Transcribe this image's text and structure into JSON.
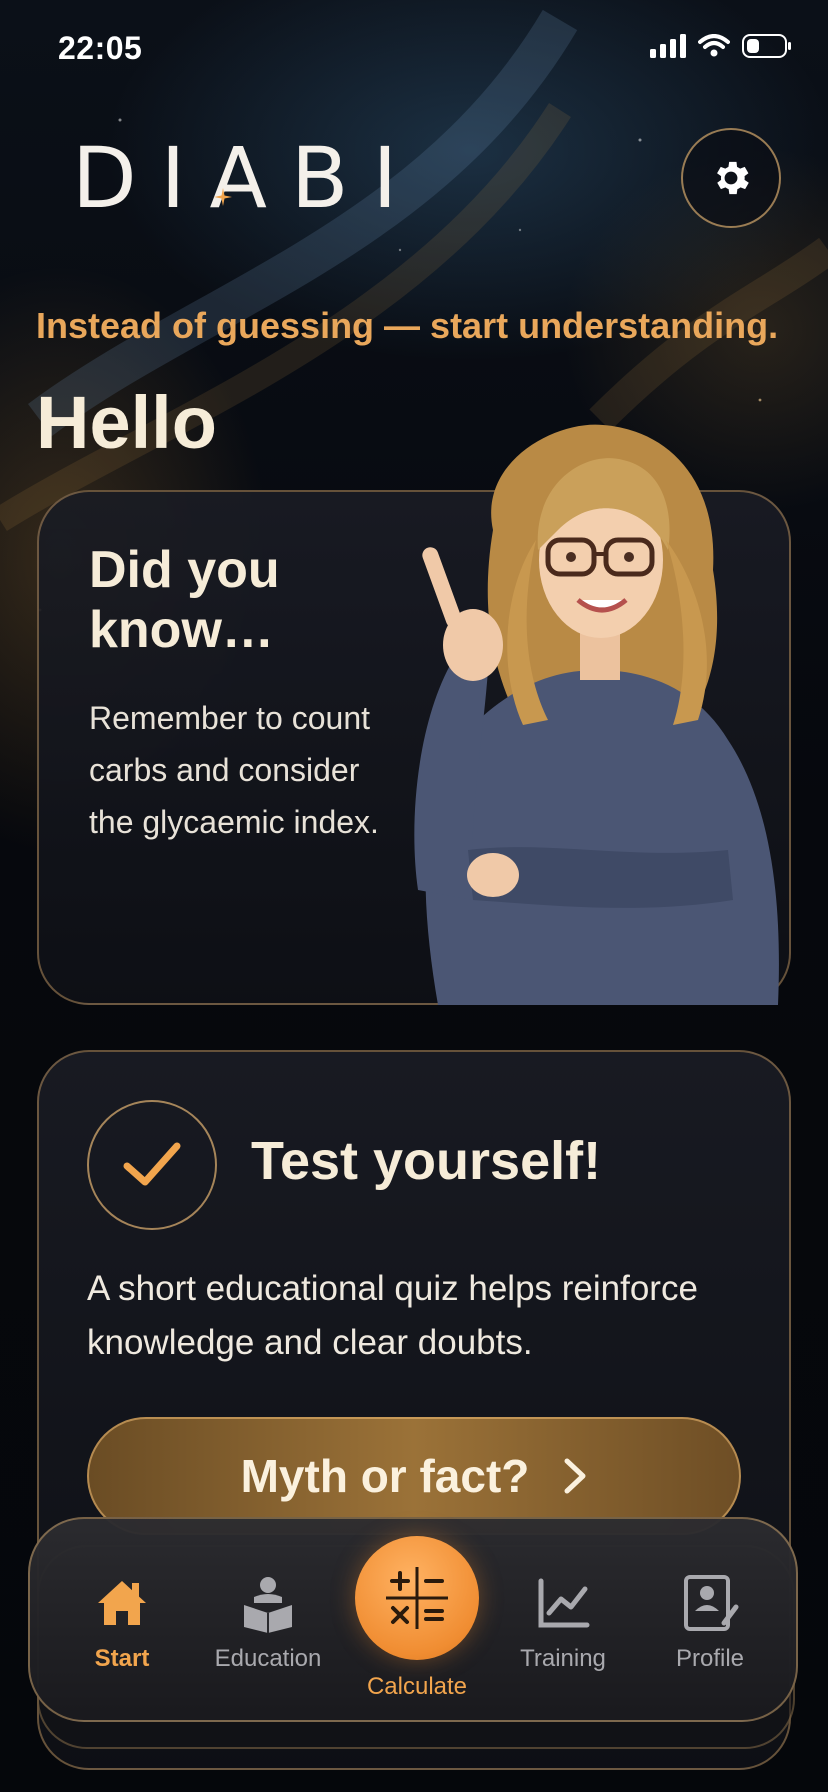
{
  "status_bar": {
    "time": "22:05"
  },
  "header": {
    "logo": "DIABI",
    "settings_icon": "gear-icon"
  },
  "tagline": "Instead of guessing — start understanding.",
  "greeting": "Hello",
  "did_you_know": {
    "title": "Did you know…",
    "body": "Remember to count carbs and consider the glycaemic index."
  },
  "quiz": {
    "title": "Test yourself!",
    "body": "A short educational quiz helps reinforce knowledge and clear doubts.",
    "button_label": "Myth or fact?"
  },
  "nav": {
    "items": [
      {
        "label": "Start",
        "icon": "home-icon",
        "active": true
      },
      {
        "label": "Education",
        "icon": "reader-icon",
        "active": false
      },
      {
        "label": "Calculate",
        "icon": "calculator-icon",
        "active": false
      },
      {
        "label": "Training",
        "icon": "chart-icon",
        "active": false
      },
      {
        "label": "Profile",
        "icon": "profile-icon",
        "active": false
      }
    ]
  },
  "colors": {
    "accent": "#f2a54d",
    "tagline": "#e9a75b",
    "card_border": "#d2a569",
    "background": "#05070c"
  }
}
